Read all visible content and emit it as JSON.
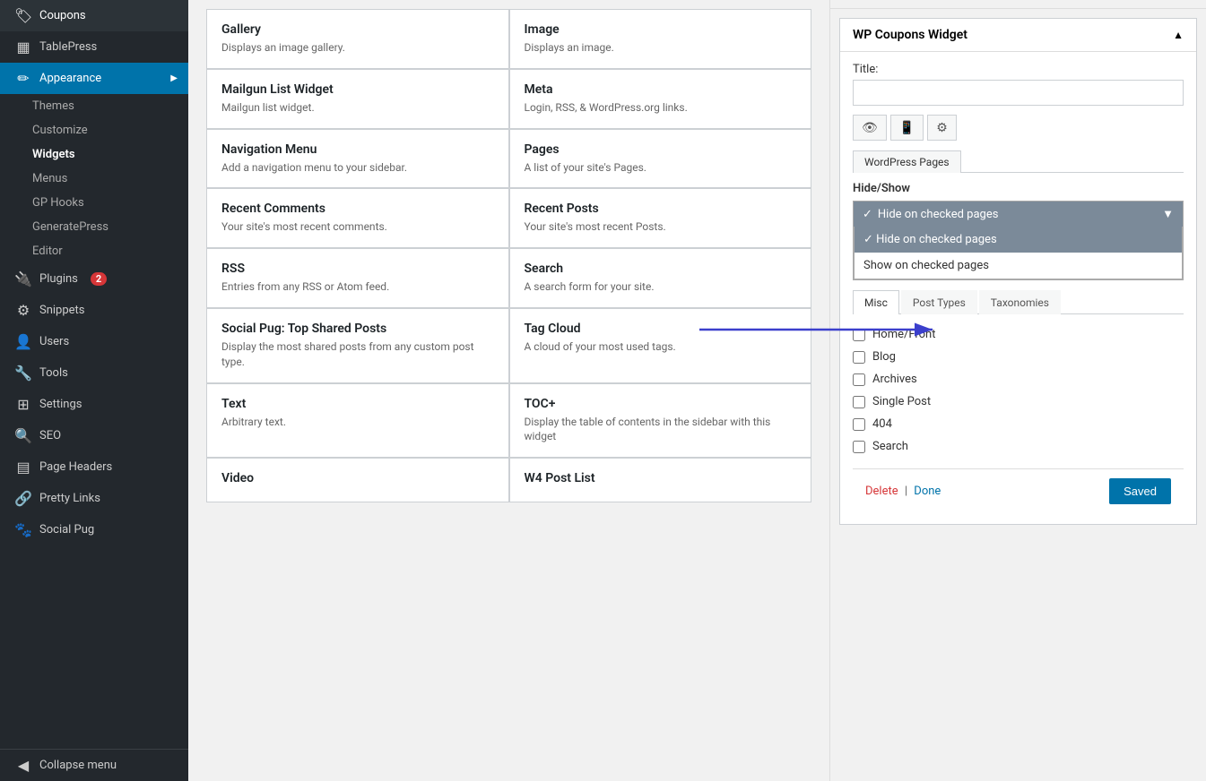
{
  "sidebar": {
    "items": [
      {
        "id": "coupons",
        "label": "Coupons",
        "icon": "🏷",
        "badge": null
      },
      {
        "id": "tablepress",
        "label": "TablePress",
        "icon": "⊞",
        "badge": null
      },
      {
        "id": "appearance",
        "label": "Appearance",
        "icon": "✏",
        "badge": null,
        "active": true
      },
      {
        "id": "plugins",
        "label": "Plugins",
        "icon": "🔌",
        "badge": "2"
      },
      {
        "id": "snippets",
        "label": "Snippets",
        "icon": "⚙",
        "badge": null
      },
      {
        "id": "users",
        "label": "Users",
        "icon": "👤",
        "badge": null
      },
      {
        "id": "tools",
        "label": "Tools",
        "icon": "🔧",
        "badge": null
      },
      {
        "id": "settings",
        "label": "Settings",
        "icon": "⊞",
        "badge": null
      },
      {
        "id": "seo",
        "label": "SEO",
        "icon": "🔍",
        "badge": null
      },
      {
        "id": "page-headers",
        "label": "Page Headers",
        "icon": "⊟",
        "badge": null
      },
      {
        "id": "pretty-links",
        "label": "Pretty Links",
        "icon": "🔗",
        "badge": null
      },
      {
        "id": "social-pug",
        "label": "Social Pug",
        "icon": "🐾",
        "badge": null
      },
      {
        "id": "collapse-menu",
        "label": "Collapse menu",
        "icon": "◀",
        "badge": null
      }
    ],
    "submenu": {
      "parent": "appearance",
      "items": [
        {
          "id": "themes",
          "label": "Themes",
          "active": false
        },
        {
          "id": "customize",
          "label": "Customize",
          "active": false
        },
        {
          "id": "widgets",
          "label": "Widgets",
          "active": true
        },
        {
          "id": "menus",
          "label": "Menus",
          "active": false
        },
        {
          "id": "gp-hooks",
          "label": "GP Hooks",
          "active": false
        },
        {
          "id": "generatepress",
          "label": "GeneratePress",
          "active": false
        },
        {
          "id": "editor",
          "label": "Editor",
          "active": false
        }
      ]
    }
  },
  "widget_cards": [
    {
      "title": "Gallery",
      "desc": "Displays an image gallery."
    },
    {
      "title": "Image",
      "desc": "Displays an image."
    },
    {
      "title": "Mailgun List Widget",
      "desc": "Mailgun list widget."
    },
    {
      "title": "Meta",
      "desc": "Login, RSS, & WordPress.org links."
    },
    {
      "title": "Navigation Menu",
      "desc": "Add a navigation menu to your sidebar."
    },
    {
      "title": "Pages",
      "desc": "A list of your site's Pages."
    },
    {
      "title": "Recent Comments",
      "desc": "Your site's most recent comments."
    },
    {
      "title": "Recent Posts",
      "desc": "Your site's most recent Posts."
    },
    {
      "title": "RSS",
      "desc": "Entries from any RSS or Atom feed."
    },
    {
      "title": "Search",
      "desc": "A search form for your site."
    },
    {
      "title": "Social Pug: Top Shared Posts",
      "desc": "Display the most shared posts from any custom post type."
    },
    {
      "title": "Tag Cloud",
      "desc": "A cloud of your most used tags."
    },
    {
      "title": "Text",
      "desc": "Arbitrary text."
    },
    {
      "title": "TOC+",
      "desc": "Display the table of contents in the sidebar with this widget"
    },
    {
      "title": "Video",
      "desc": ""
    },
    {
      "title": "W4 Post List",
      "desc": ""
    }
  ],
  "right_panel": {
    "widget_title": "WP Coupons Widget",
    "title_label": "Title:",
    "title_value": "",
    "icons": [
      "👁",
      "📱",
      "⚙"
    ],
    "wp_pages_tab": "WordPress Pages",
    "hide_show_label": "Hide/Show",
    "dropdown": {
      "selected": "Hide on checked pages",
      "options": [
        "Hide on checked pages",
        "Show on checked pages"
      ]
    },
    "misc_tabs": [
      "Misc",
      "Post Types",
      "Taxonomies"
    ],
    "active_misc_tab": "Misc",
    "checkboxes": [
      {
        "label": "Home/Front",
        "checked": false
      },
      {
        "label": "Blog",
        "checked": false
      },
      {
        "label": "Archives",
        "checked": false
      },
      {
        "label": "Single Post",
        "checked": false
      },
      {
        "label": "404",
        "checked": false
      },
      {
        "label": "Search",
        "checked": false
      }
    ],
    "footer": {
      "delete_label": "Delete",
      "separator": "|",
      "done_label": "Done",
      "saved_label": "Saved"
    }
  }
}
